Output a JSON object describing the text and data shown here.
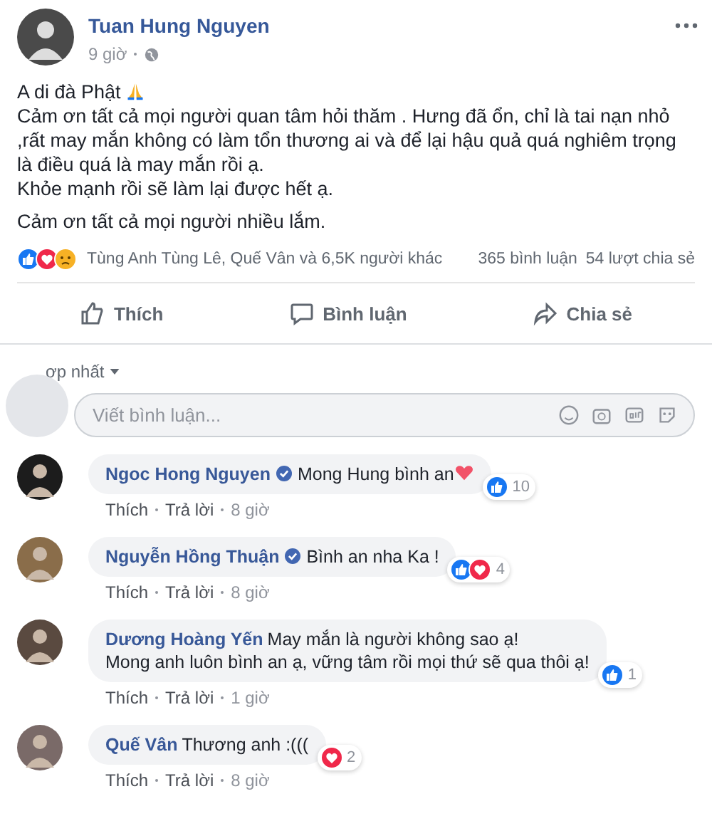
{
  "post": {
    "author": "Tuan Hung Nguyen",
    "time": "9 giờ",
    "paragraphs": [
      {
        "lines": [
          {
            "text": "A di đà Phật",
            "pray_emoji": true
          },
          {
            "text": "Cảm ơn tất cả mọi người quan tâm hỏi thăm . Hưng đã ổn, chỉ là tai nạn nhỏ ,rất may mắn không có làm tổn thương ai và để lại hậu quả quá nghiêm trọng là điều quá là may mắn rồi ạ."
          },
          {
            "text": "Khỏe mạnh rồi sẽ làm lại được hết ạ."
          }
        ]
      },
      {
        "lines": [
          {
            "text": "Cảm ơn tất cả mọi người nhiều lắm."
          }
        ]
      }
    ],
    "reactions": [
      {
        "kind": "like"
      },
      {
        "kind": "love"
      },
      {
        "kind": "sad"
      }
    ],
    "reacted_by": "Tùng Anh Tùng Lê, Quế Vân và 6,5K người khác",
    "comments_count": "365 bình luận",
    "shares": "54 lượt chia sẻ"
  },
  "actions": [
    {
      "kind": "like",
      "label": "Thích"
    },
    {
      "kind": "comment",
      "label": "Bình luận"
    },
    {
      "kind": "share",
      "label": "Chia sẻ"
    }
  ],
  "sort": "ợp nhất",
  "comment_input": {
    "placeholder": "Viết bình luận..."
  },
  "comments": [
    {
      "name": "Ngoc Hong Nguyen",
      "verified": true,
      "lines": [
        "Mong Hung bình an"
      ],
      "heart_emoji": true,
      "reactions": [
        {
          "kind": "like"
        }
      ],
      "count": "10",
      "like": "Thích",
      "reply": "Trả lời",
      "time": "8 giờ"
    },
    {
      "name": "Nguyễn Hồng Thuận",
      "verified": true,
      "lines": [
        "Bình an nha Ka !"
      ],
      "reactions": [
        {
          "kind": "like"
        },
        {
          "kind": "love"
        }
      ],
      "count": "4",
      "like": "Thích",
      "reply": "Trả lời",
      "time": "8 giờ"
    },
    {
      "name": "Dương Hoàng Yến",
      "verified": false,
      "lines": [
        "May mắn là người không sao ạ!",
        "Mong anh luôn bình an ạ, vững tâm rồi mọi thứ sẽ qua thôi ạ!"
      ],
      "reactions": [
        {
          "kind": "like"
        }
      ],
      "count": "1",
      "like": "Thích",
      "reply": "Trả lời",
      "time": "1 giờ"
    },
    {
      "name": "Quế Vân",
      "verified": false,
      "lines": [
        "Thương anh :((("
      ],
      "reactions": [
        {
          "kind": "love"
        }
      ],
      "count": "2",
      "like": "Thích",
      "reply": "Trả lời",
      "time": "8 giờ"
    }
  ]
}
